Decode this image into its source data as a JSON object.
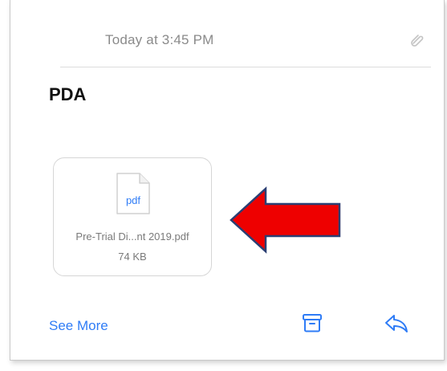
{
  "message": {
    "timestamp": "Today at 3:45 PM",
    "subject": "PDA"
  },
  "attachment": {
    "type_label": "pdf",
    "file_name": "Pre-Trial Di...nt 2019.pdf",
    "file_size": "74 KB"
  },
  "footer": {
    "see_more_label": "See More"
  },
  "icons": {
    "pin": "paperclip-icon",
    "file": "pdf-file-icon",
    "archive": "archive-icon",
    "reply": "reply-icon",
    "annotation": "red-arrow"
  },
  "colors": {
    "accent": "#2f7cf6",
    "arrow_fill": "#ee0000",
    "arrow_stroke": "#2b3f73"
  }
}
